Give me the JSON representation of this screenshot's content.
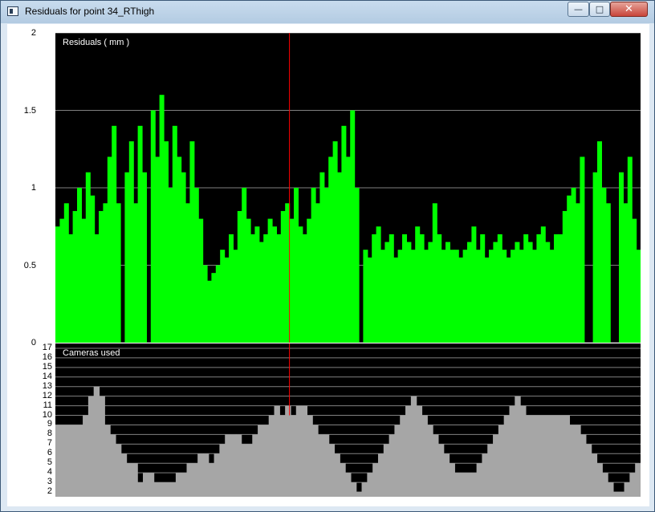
{
  "window": {
    "title": "Residuals for point 34_RThigh",
    "minimize_glyph": "—",
    "maximize_glyph": "□",
    "close_glyph": "✕"
  },
  "residuals_panel": {
    "label": "Residuals ( mm )"
  },
  "cameras_panel": {
    "label": "Cameras used"
  },
  "colors": {
    "residual_fill": "#00ff00",
    "camera_fill": "#a6a6a6",
    "background": "#000000",
    "gridline": "#808080",
    "cursor": "#ff0000"
  },
  "chart_data": [
    {
      "type": "area",
      "title": "Residuals ( mm )",
      "ylim": [
        0,
        2
      ],
      "yticks": [
        "0",
        "0.5",
        "1",
        "1.5",
        "2"
      ],
      "grid": true,
      "cursor_x_fraction": 0.4,
      "series": [
        {
          "values": [
            0.75,
            0.8,
            0.9,
            0.7,
            0.85,
            1.0,
            0.8,
            1.1,
            0.95,
            0.7,
            0.85,
            0.9,
            1.2,
            1.4,
            0.9,
            0.0,
            1.1,
            1.3,
            0.9,
            1.4,
            1.1,
            0.0,
            1.5,
            1.2,
            1.6,
            1.3,
            1.0,
            1.4,
            1.2,
            1.1,
            0.9,
            1.3,
            1.0,
            0.8,
            0.5,
            0.4,
            0.45,
            0.5,
            0.6,
            0.55,
            0.7,
            0.6,
            0.85,
            1.0,
            0.8,
            0.7,
            0.75,
            0.65,
            0.7,
            0.8,
            0.75,
            0.7,
            0.85,
            0.9,
            0.8,
            1.0,
            0.75,
            0.7,
            0.8,
            1.0,
            0.9,
            1.1,
            1.0,
            1.2,
            1.3,
            1.1,
            1.4,
            1.2,
            1.5,
            1.0,
            0.0,
            0.6,
            0.55,
            0.7,
            0.75,
            0.6,
            0.65,
            0.7,
            0.55,
            0.6,
            0.7,
            0.65,
            0.6,
            0.75,
            0.7,
            0.6,
            0.65,
            0.9,
            0.7,
            0.6,
            0.65,
            0.6,
            0.6,
            0.55,
            0.6,
            0.65,
            0.75,
            0.6,
            0.7,
            0.55,
            0.6,
            0.65,
            0.7,
            0.6,
            0.55,
            0.6,
            0.65,
            0.6,
            0.7,
            0.65,
            0.6,
            0.7,
            0.75,
            0.65,
            0.6,
            0.7,
            0.7,
            0.85,
            0.95,
            1.0,
            0.9,
            1.2,
            0.0,
            0.0,
            1.1,
            1.3,
            1.0,
            0.9,
            0.0,
            0.0,
            1.1,
            0.9,
            1.2,
            0.8,
            0.6
          ],
          "scale_note": "values in mm, one value per frame-group left to right"
        }
      ]
    },
    {
      "type": "area",
      "title": "Cameras used",
      "ylim": [
        1.5,
        17.5
      ],
      "yticks": [
        "2",
        "3",
        "4",
        "5",
        "6",
        "7",
        "8",
        "9",
        "10",
        "11",
        "12",
        "13",
        "14",
        "15",
        "16",
        "17"
      ],
      "grid": true,
      "cursor_x_fraction": 0.4,
      "series": [
        {
          "values": [
            9,
            9,
            9,
            9,
            9,
            10,
            12,
            13,
            12,
            9,
            8,
            7,
            6,
            5,
            5,
            3,
            4,
            4,
            3,
            3,
            3,
            3,
            4,
            4,
            5,
            5,
            6,
            6,
            5,
            6,
            7,
            8,
            8,
            8,
            7,
            7,
            8,
            9,
            9,
            10,
            11,
            10,
            11,
            10,
            11,
            11,
            10,
            9,
            8,
            8,
            7,
            6,
            5,
            4,
            3,
            2,
            3,
            4,
            5,
            6,
            7,
            8,
            9,
            10,
            11,
            12,
            11,
            10,
            9,
            8,
            7,
            6,
            5,
            4,
            4,
            4,
            4,
            5,
            6,
            7,
            8,
            9,
            10,
            11,
            12,
            11,
            10,
            10,
            10,
            10,
            10,
            10,
            10,
            10,
            9,
            9,
            8,
            7,
            6,
            5,
            4,
            3,
            2,
            2,
            3,
            4,
            5
          ]
        }
      ]
    }
  ]
}
